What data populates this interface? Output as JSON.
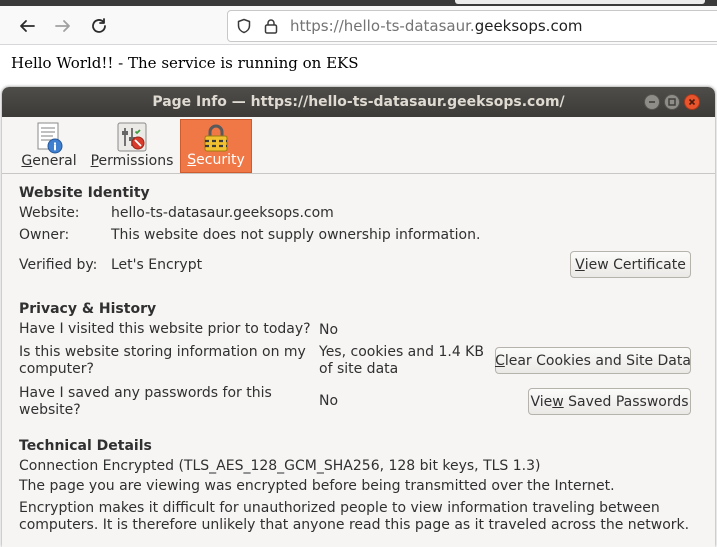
{
  "browser": {
    "url_faded": "https://hello-ts-datasaur.",
    "url_bold": "geeksops.com"
  },
  "page": {
    "content_text": "Hello World!! - The service is running on EKS"
  },
  "dialog": {
    "title": "Page Info — https://hello-ts-datasaur.geeksops.com/",
    "tabs": [
      {
        "label": "General",
        "active": false
      },
      {
        "label": "Permissions",
        "active": false
      },
      {
        "label": "Security",
        "active": true
      }
    ],
    "identity": {
      "heading": "Website Identity",
      "website_label": "Website:",
      "website_value": "hello-ts-datasaur.geeksops.com",
      "owner_label": "Owner:",
      "owner_value": "This website does not supply ownership information.",
      "verified_label": "Verified by:",
      "verified_value": "Let's Encrypt",
      "view_certificate": "View Certificate"
    },
    "privacy": {
      "heading": "Privacy & History",
      "q1": "Have I visited this website prior to today?",
      "a1": "No",
      "q2_line1": "Is this website storing information on my",
      "q2_line2": "computer?",
      "a2_line1": "Yes, cookies and 1.4 KB",
      "a2_line2": "of site data",
      "clear_cookies": "Clear Cookies and Site Data",
      "q3_line1": "Have I saved any passwords for this",
      "q3_line2": "website?",
      "a3": "No",
      "view_passwords": "View Saved Passwords"
    },
    "technical": {
      "heading": "Technical Details",
      "line1": "Connection Encrypted (TLS_AES_128_GCM_SHA256, 128 bit keys, TLS 1.3)",
      "line2": "The page you are viewing was encrypted before being transmitted over the Internet.",
      "line3": "Encryption makes it difficult for unauthorized people to view information traveling between",
      "line4": "computers. It is therefore unlikely that anyone read this page as it traveled across the network."
    }
  },
  "colors": {
    "active_tab": "#f07746",
    "titlebar": "#3c3b37",
    "close_button": "#e9542c"
  }
}
